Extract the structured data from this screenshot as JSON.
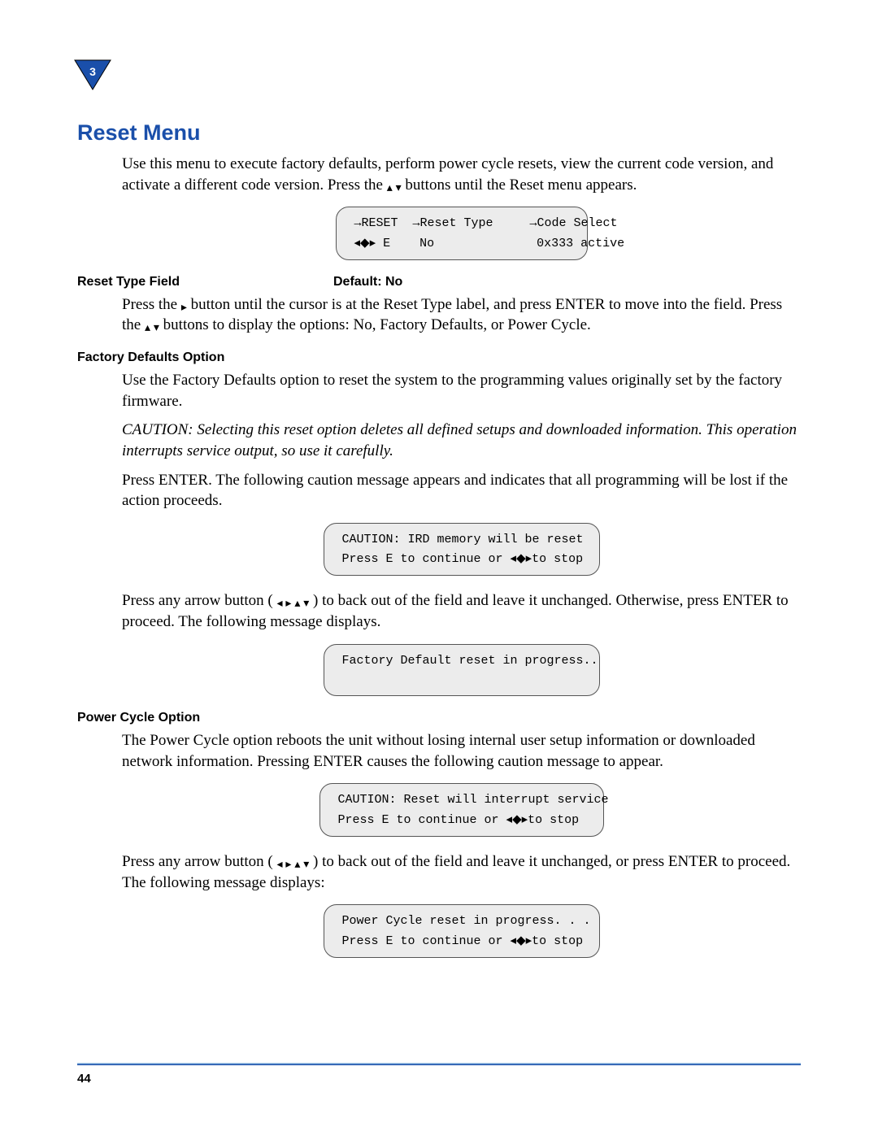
{
  "chapter_number": "3",
  "h1": "Reset Menu",
  "intro_a": "Use this menu to execute factory defaults, perform power cycle resets, view the current code version, and activate a different code version. Press the ",
  "intro_b": " buttons until the Reset menu appears.",
  "lcd1_line1_a": "→RESET  →Reset Type     →Code Select",
  "lcd1_line2_nav": "◂◆▸",
  "lcd1_line2_rest": " E    No              0x333 active",
  "field_left": "Reset Type Field",
  "field_right": "Default: No",
  "reset_type_a": "Press the ",
  "reset_type_b": " button until the cursor is at the Reset Type label, and press ENTER to move into the field. Press the ",
  "reset_type_c": " buttons to display the options: No, Factory Defaults, or Power Cycle.",
  "factory_head": "Factory Defaults Option",
  "factory_p": "Use the Factory Defaults option to reset the system to the programming values originally set by the factory firmware.",
  "caution": "CAUTION:  Selecting this reset option deletes all defined setups and downloaded information. This operation interrupts service output, so use it carefully.",
  "enter_p": "Press ENTER. The following caution message appears and indicates that all programming will be lost if the action proceeds.",
  "lcd2_line1": "CAUTION: IRD memory will be reset",
  "lcd2_line2_a": "Press E to continue or ",
  "lcd2_line2_b": "to stop",
  "backout_a": "Press any arrow button ( ",
  "backout_b": " ) to back out of the field and leave it unchanged. Otherwise, press ENTER to proceed. The following message displays.",
  "lcd3_line1": "Factory Default reset in progress..",
  "lcd3_line2": " ",
  "power_head": "Power Cycle Option",
  "power_p": "The Power Cycle option reboots the unit without losing internal user setup information or downloaded network information. Pressing ENTER causes the following caution message to appear.",
  "lcd4_line1": "CAUTION: Reset will interrupt service",
  "lcd4_line2_a": "Press E to continue or ",
  "lcd4_line2_b": "to stop",
  "backout2_a": "Press any arrow button ( ",
  "backout2_b": " ) to back out of the field and leave it unchanged, or press ENTER to proceed. The following message displays:",
  "lcd5_line1": "Power Cycle reset in progress. . .",
  "lcd5_line2_a": "Press E to continue or ",
  "lcd5_line2_b": "to stop",
  "page_number": "44"
}
